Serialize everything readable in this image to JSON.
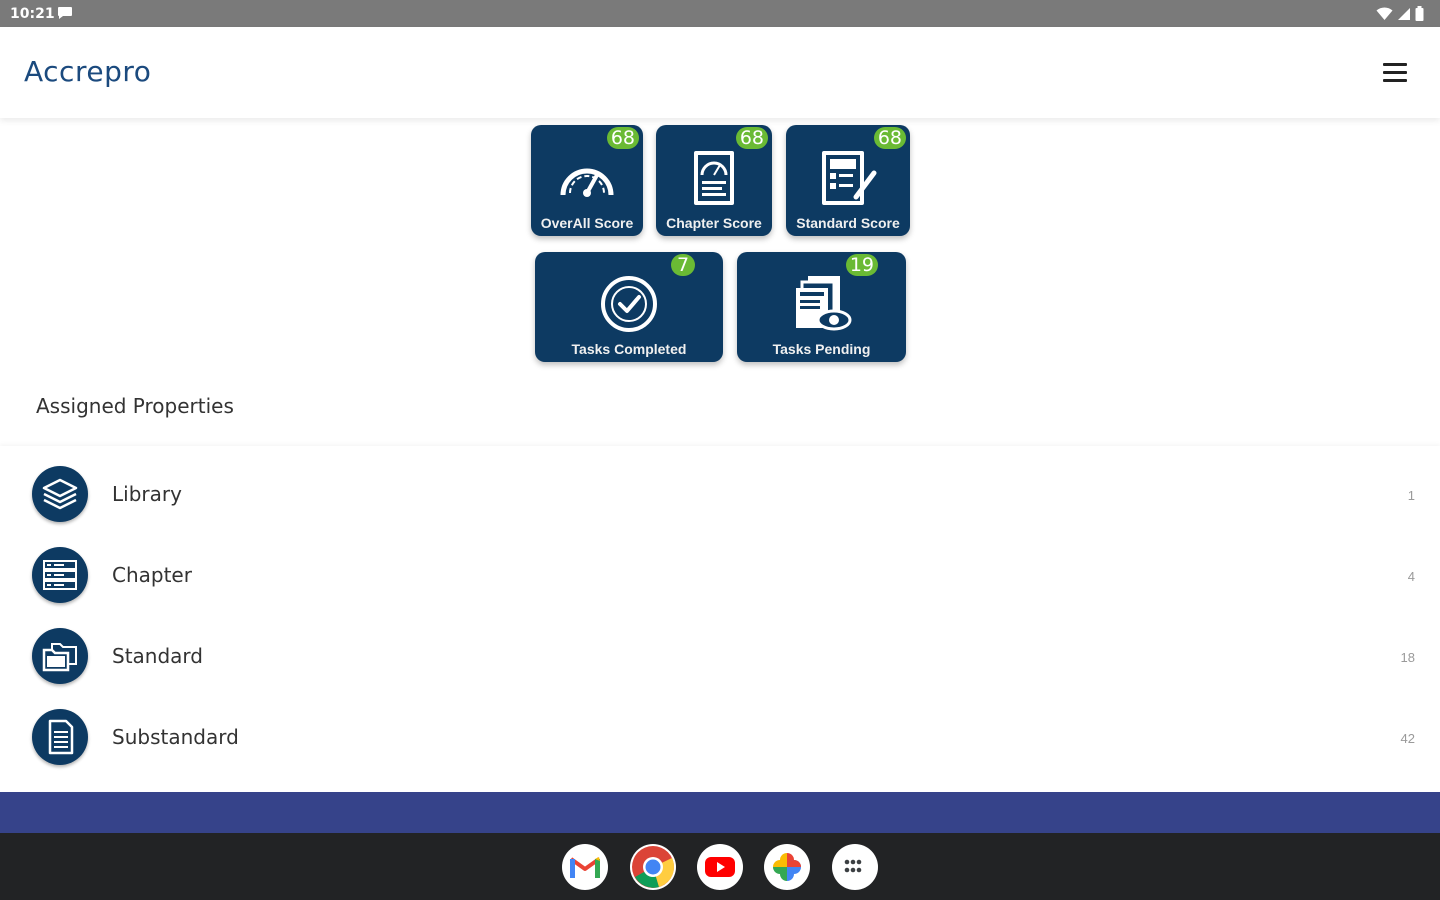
{
  "status_bar": {
    "time": "10:21"
  },
  "header": {
    "logo": "Accrepro"
  },
  "tiles": [
    {
      "label": "OverAll Score",
      "badge": "68"
    },
    {
      "label": "Chapter Score",
      "badge": "68"
    },
    {
      "label": "Standard Score",
      "badge": "68"
    },
    {
      "label": "Tasks Completed",
      "badge": "7"
    },
    {
      "label": "Tasks Pending",
      "badge": "19"
    }
  ],
  "section": {
    "title": "Assigned Properties"
  },
  "properties": [
    {
      "label": "Library",
      "count": "1"
    },
    {
      "label": "Chapter",
      "count": "4"
    },
    {
      "label": "Standard",
      "count": "18"
    },
    {
      "label": "Substandard",
      "count": "42"
    }
  ],
  "colors": {
    "tile_bg": "#0d3a62",
    "badge_bg": "#6aba34",
    "band": "#36438a",
    "taskbar": "#222325"
  },
  "dock": {
    "icons": [
      "gmail-icon",
      "chrome-icon",
      "youtube-icon",
      "photos-icon",
      "app-launcher-icon"
    ]
  }
}
